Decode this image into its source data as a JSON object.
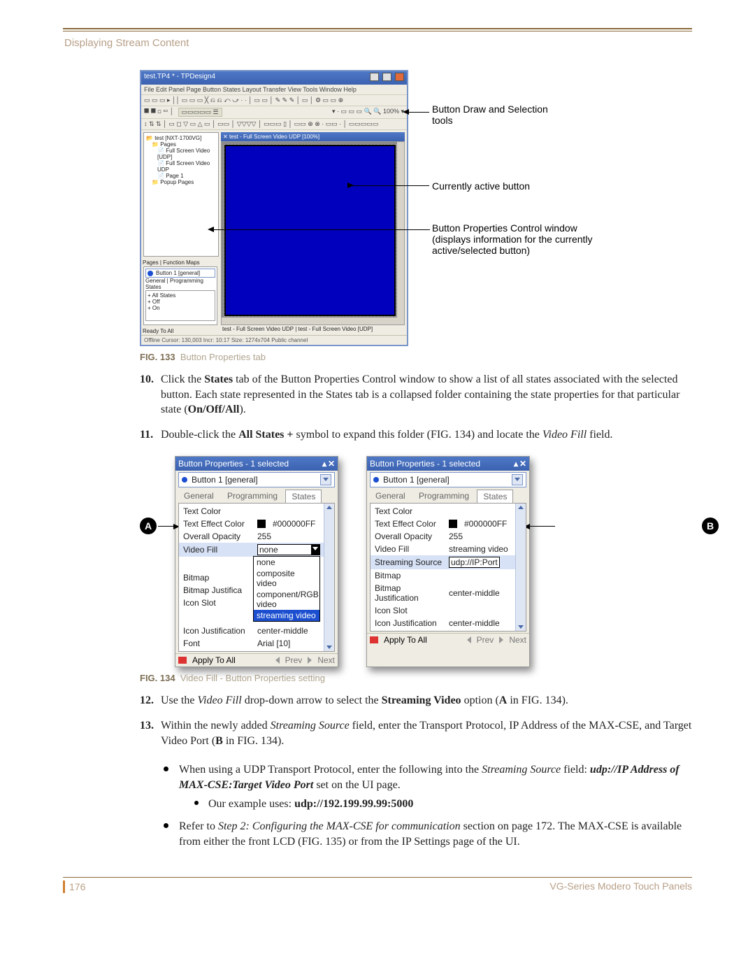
{
  "header": {
    "breadcrumb": "Displaying Stream Content"
  },
  "fig133": {
    "window_title": "test.TP4 * - TPDesign4",
    "menu": "File  Edit  Panel  Page  Button  States  Layout  Transfer  View  Tools  Window  Help",
    "tree_root": "test [NXT-1700VG]",
    "tree_items": [
      "Pages",
      "Full Screen Video [UDP]",
      "Full Screen Video UDP",
      "Page 1",
      "Popup Pages"
    ],
    "tree_tabs": "Pages | Function Maps",
    "canvas_title": "test - Full Screen Video UDP [100%]",
    "props_header": "Button 1 [general]",
    "props_tabs": "General | Programming  States",
    "props_rows": "All States\\nOff\\nOn",
    "ready": "Ready To All",
    "status_tabs": "test - Full Screen Video UDP  |  test - Full Screen Video [UDP]",
    "status_right": "Offline     Cursor: 130,003   Incr: 10:17   Size: 1274x704  Public channel",
    "callout1": "Button Draw and Selection tools",
    "callout2": "Currently active button",
    "callout3": "Button Properties Control window (displays information for the currently active/selected button)",
    "caption_label": "FIG. 133",
    "caption": "Button Properties tab"
  },
  "steps": {
    "s10": {
      "num": "10.",
      "pre": "Click the ",
      "bold1": "States",
      "mid": " tab of the Button Properties Control window to show a list of all states associated with the selected button. Each state represented in the States tab is a collapsed folder containing the state properties for that particular state (",
      "bold2": "On/Off/All",
      "post": ")."
    },
    "s11": {
      "num": "11.",
      "pre": "Double-click the ",
      "bold1": "All States +",
      "mid": " symbol to expand this folder (FIG. 134) and locate the ",
      "ital1": "Video Fill",
      "post": " field."
    },
    "s12": {
      "num": "12.",
      "pre": "Use the ",
      "ital1": "Video Fill",
      "mid": " drop-down arrow to select the ",
      "bold1": "Streaming Video",
      "post": " option (",
      "bold2": "A",
      "post2": " in FIG. 134)."
    },
    "s13": {
      "num": "13.",
      "pre": "Within the newly added ",
      "ital1": "Streaming Source",
      "mid": " field, enter the Transport Protocol, IP Address of the MAX-CSE, and Target Video Port (",
      "bold1": "B",
      "post": " in FIG. 134)."
    }
  },
  "fig134": {
    "panel_title": "Button Properties - 1 selected",
    "selected": "Button 1  [general]",
    "tabs": [
      "General",
      "Programming",
      "States"
    ],
    "prop_labels": {
      "textcolor": "Text Color",
      "texteffect": "Text Effect Color",
      "texteffect_val": "#000000FF",
      "opacity": "Overall Opacity",
      "opacity_val": "255",
      "videofill": "Video Fill",
      "bitmap": "Bitmap",
      "bmpjust_short": "Bitmap Justifica",
      "bmpjust_full": "Bitmap Justification",
      "bmpjust_val": "center-middle",
      "iconslot": "Icon Slot",
      "iconjust": "Icon Justification",
      "iconjust_val": "center-middle",
      "font": "Font",
      "font_val": "Arial [10]",
      "streamsrc": "Streaming Source",
      "streamsrc_val": "udp://IP:Port"
    },
    "videofill_valA": "none",
    "videofill_opts": [
      "none",
      "composite video",
      "component/RGB video",
      "streaming video"
    ],
    "videofill_valB": "streaming video",
    "apply": "Apply To All",
    "prev": "Prev",
    "next": "Next",
    "badgeA": "A",
    "badgeB": "B",
    "caption_label": "FIG. 134",
    "caption": "Video Fill - Button Properties setting"
  },
  "bullets": {
    "b1_pre": "When using a UDP Transport Protocol, enter the following into the ",
    "b1_ital": "Streaming Source",
    "b1_post": " field: ",
    "b1_bi": "udp://IP Address of MAX-CSE:Target Video Port",
    "b1_tail": " set on the UI page.",
    "b1_sub_pre": "Our example uses: ",
    "b1_sub_bold": "udp://192.199.99.99:5000",
    "b2_pre": "Refer to ",
    "b2_ital": "Step 2: Configuring the MAX-CSE for communication",
    "b2_post": " section on page 172. The MAX-CSE is available from either the front LCD (FIG. 135) or from the IP Settings page of the UI."
  },
  "footer": {
    "page": "176",
    "doc": "VG-Series Modero Touch Panels"
  }
}
